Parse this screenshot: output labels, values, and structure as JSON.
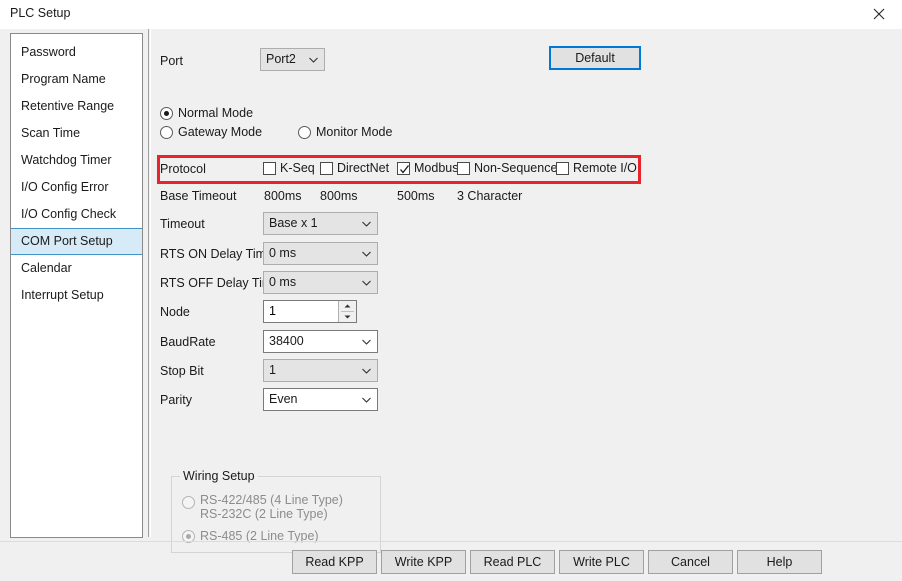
{
  "window": {
    "title": "PLC Setup",
    "close_icon": "close-icon"
  },
  "sidebar": {
    "items": [
      {
        "label": "Password",
        "selected": false
      },
      {
        "label": "Program Name",
        "selected": false
      },
      {
        "label": "Retentive Range",
        "selected": false
      },
      {
        "label": "Scan Time",
        "selected": false
      },
      {
        "label": "Watchdog Timer",
        "selected": false
      },
      {
        "label": "I/O Config Error",
        "selected": false
      },
      {
        "label": "I/O Config Check",
        "selected": false
      },
      {
        "label": "COM Port Setup",
        "selected": true
      },
      {
        "label": "Calendar",
        "selected": false
      },
      {
        "label": "Interrupt Setup",
        "selected": false
      }
    ]
  },
  "main": {
    "port": {
      "label": "Port",
      "value": "Port2"
    },
    "default_button": "Default",
    "modes": [
      {
        "label": "Normal Mode",
        "checked": true
      },
      {
        "label": "Gateway Mode",
        "checked": false
      },
      {
        "label": "Monitor Mode",
        "checked": false
      }
    ],
    "protocol": {
      "label": "Protocol",
      "options": [
        {
          "label": "K-Seq",
          "checked": false
        },
        {
          "label": "DirectNet",
          "checked": false
        },
        {
          "label": "Modbus",
          "checked": true
        },
        {
          "label": "Non-Sequence",
          "checked": false
        },
        {
          "label": "Remote I/O",
          "checked": false
        }
      ]
    },
    "base_timeout": {
      "label": "Base Timeout",
      "values": [
        "800ms",
        "800ms",
        "500ms",
        "3 Character"
      ]
    },
    "fields": [
      {
        "label": "Timeout",
        "value": "Base x 1",
        "disabled": true
      },
      {
        "label": "RTS ON Delay Time",
        "value": "0 ms",
        "disabled": true
      },
      {
        "label": "RTS OFF Delay Time",
        "value": "0 ms",
        "disabled": true
      },
      {
        "label": "BaudRate",
        "value": "38400",
        "disabled": false
      },
      {
        "label": "Stop Bit",
        "value": "1",
        "disabled": true
      },
      {
        "label": "Parity",
        "value": "Even",
        "disabled": false
      }
    ],
    "node": {
      "label": "Node",
      "value": "1"
    },
    "wiring_setup": {
      "title": "Wiring Setup",
      "options": [
        {
          "label_line1": "RS-422/485 (4 Line Type)",
          "label_line2": "RS-232C (2 Line Type)",
          "checked": false,
          "disabled": true
        },
        {
          "label_line1": "RS-485 (2 Line Type)",
          "label_line2": "",
          "checked": true,
          "disabled": true
        }
      ]
    }
  },
  "footer": {
    "buttons": [
      "Read KPP",
      "Write KPP",
      "Read PLC",
      "Write PLC",
      "Cancel",
      "Help"
    ]
  },
  "colors": {
    "highlight_red": "#e8232a",
    "focus_blue": "#0078d7",
    "selection_blue": "#d6ebf7"
  }
}
